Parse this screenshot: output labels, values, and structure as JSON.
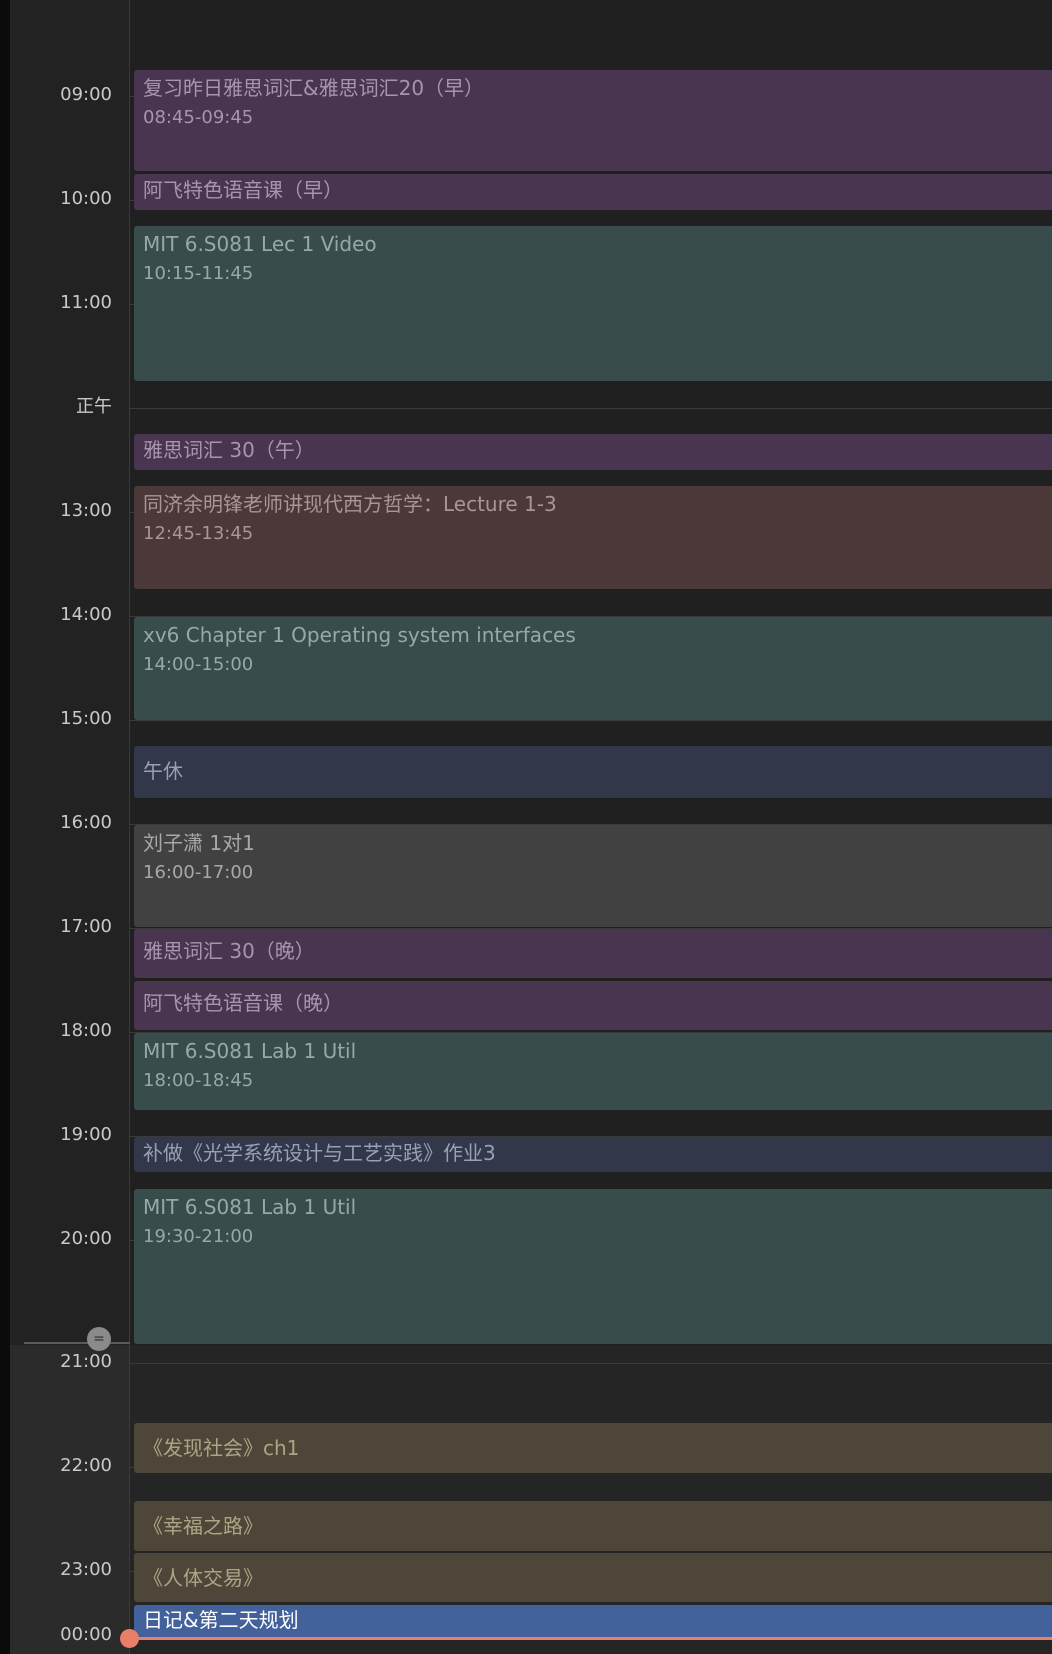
{
  "hour_labels": {
    "h09": "09:00",
    "h10": "10:00",
    "h11": "11:00",
    "noon": "正午",
    "h13": "13:00",
    "h14": "14:00",
    "h15": "15:00",
    "h16": "16:00",
    "h17": "17:00",
    "h18": "18:00",
    "h19": "19:00",
    "h20": "20:00",
    "h21": "21:00",
    "h22": "22:00",
    "h23": "23:00",
    "h00": "00:00"
  },
  "events": [
    {
      "title": "复习昨日雅思词汇&雅思词汇20（早）",
      "time": "08:45-09:45",
      "color": "#4a3550"
    },
    {
      "title": "阿飞特色语音课（早）",
      "color": "#4a3550"
    },
    {
      "title": "MIT 6.S081 Lec 1 Video",
      "time": "10:15-11:45",
      "color": "#384c4b"
    },
    {
      "title": "雅思词汇 30（午）",
      "color": "#4a3550"
    },
    {
      "title": "同济余明锋老师讲现代西方哲学：Lecture 1-3",
      "time": "12:45-13:45",
      "color": "#4b3838"
    },
    {
      "title": "xv6 Chapter 1 Operating system interfaces",
      "time": "14:00-15:00",
      "color": "#384c4b"
    },
    {
      "title": "午休",
      "color": "#323749"
    },
    {
      "title": "刘子潇 1对1",
      "time": "16:00-17:00",
      "color": "#414141"
    },
    {
      "title": "雅思词汇 30（晚）",
      "color": "#4a3550"
    },
    {
      "title": "阿飞特色语音课（晚）",
      "color": "#4a3550"
    },
    {
      "title": "MIT 6.S081 Lab 1 Util",
      "time": "18:00-18:45",
      "color": "#384c4b"
    },
    {
      "title": "补做《光学系统设计与工艺实践》作业3",
      "color": "#323749"
    },
    {
      "title": "MIT 6.S081 Lab 1 Util",
      "time": "19:30-21:00",
      "color": "#384c4b"
    },
    {
      "title": "《发现社会》ch1",
      "color": "#4e4638"
    },
    {
      "title": "《幸福之路》",
      "color": "#4e4638"
    },
    {
      "title": "《人体交易》",
      "color": "#4e4638"
    },
    {
      "title": "日记&第二天规划",
      "color": "#43619a"
    }
  ],
  "colors": {
    "current_time_indicator": "#ea7f69",
    "background": "#1e1e1e"
  },
  "divider_icon": "equals-icon"
}
